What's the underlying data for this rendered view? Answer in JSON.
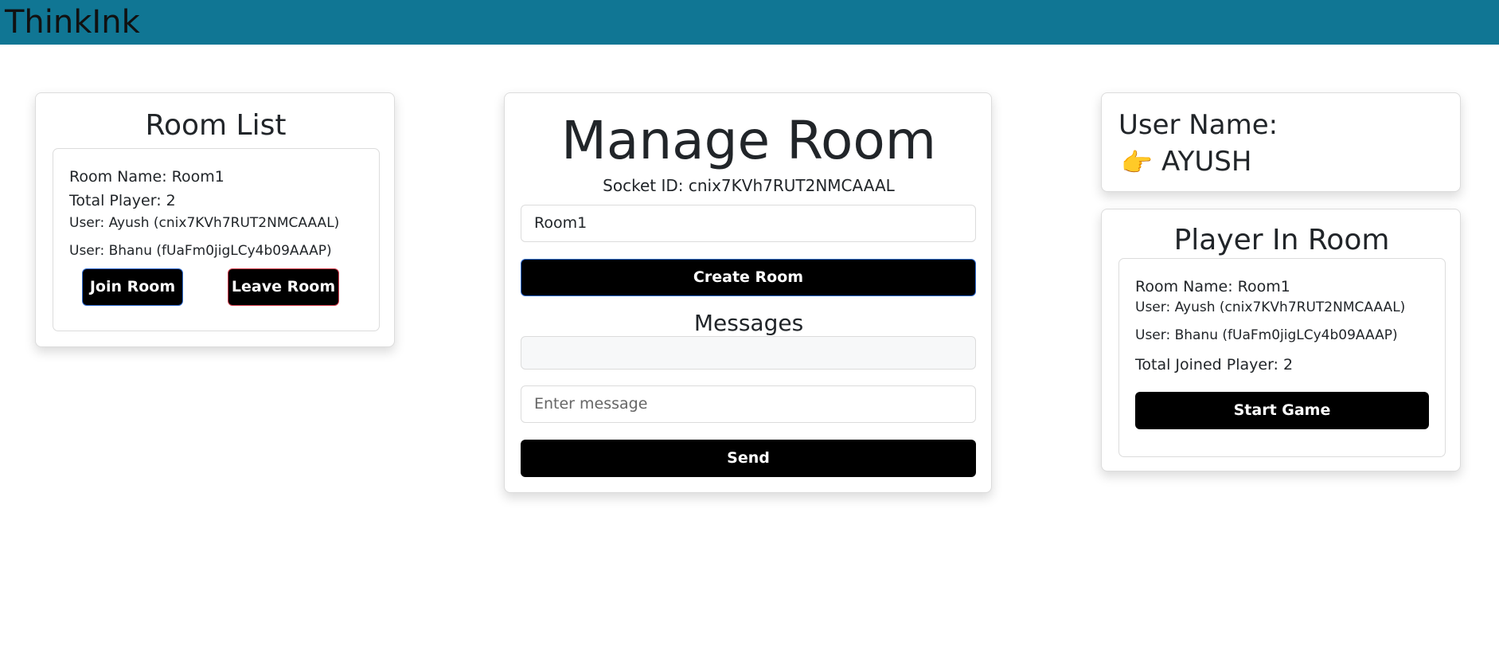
{
  "app": {
    "brand": "ThinkInk"
  },
  "room_list": {
    "title": "Room List",
    "room_name": "Room Name: Room1",
    "total_player": "Total Player: 2",
    "users": [
      "User: Ayush (cnix7KVh7RUT2NMCAAAL)",
      "User: Bhanu (fUaFm0jigLCy4b09AAAP)"
    ],
    "join_label": "Join Room",
    "leave_label": "Leave Room"
  },
  "manage_room": {
    "title": "Manage Room",
    "socket_id": "Socket ID: cnix7KVh7RUT2NMCAAAL",
    "room_input_value": "Room1",
    "create_label": "Create Room",
    "messages_title": "Messages",
    "message_placeholder": "Enter message",
    "send_label": "Send"
  },
  "user": {
    "label": "User Name:",
    "pointer_icon": "👉",
    "value": "AYUSH"
  },
  "player_in_room": {
    "title": "Player In Room",
    "room_name": "Room Name: Room1",
    "users": [
      "User: Ayush (cnix7KVh7RUT2NMCAAAL)",
      "User: Bhanu (fUaFm0jigLCy4b09AAAP)"
    ],
    "total_joined": "Total Joined Player: 2",
    "start_label": "Start Game"
  },
  "colors": {
    "topbar": "#107694",
    "button": "#000000",
    "join_border": "#2f6bd1",
    "leave_border": "#d33a4a"
  }
}
